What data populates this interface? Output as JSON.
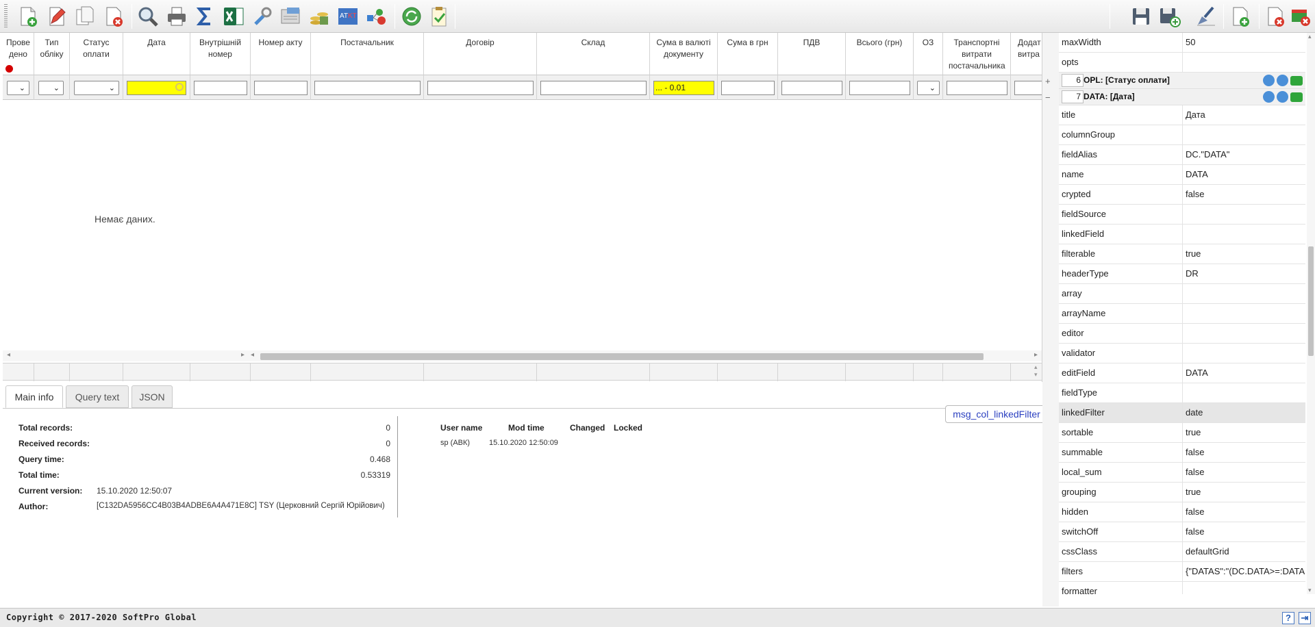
{
  "toolbar": {
    "left_icons": [
      "new-document-icon",
      "edit-icon",
      "copy-icon",
      "delete-icon",
      "search-icon",
      "print-icon",
      "sum-icon",
      "excel-icon",
      "settings-wrench-icon",
      "log-icon",
      "money-icon",
      "convert-icon",
      "dependencies-icon",
      "refresh-icon",
      "approve-icon"
    ],
    "right_icons": [
      "save-icon",
      "save-as-icon",
      "clear-icon",
      "add-column-icon",
      "delete-column-icon",
      "delete-all-icon"
    ]
  },
  "grid": {
    "columns": [
      "Прове дено",
      "Тип обліку",
      "Статус оплати",
      "Дата",
      "Внутрішній номер",
      "Номер акту",
      "Постачальник",
      "Договір",
      "Склад",
      "Сума в валюті документу",
      "Сума в грн",
      "ПДВ",
      "Всього (грн)",
      "ОЗ",
      "Транспортні витрати постачальника",
      "Додат витра"
    ],
    "filter_sum_value": "... - 0.01",
    "empty_message": "Немає даних."
  },
  "tabs": [
    "Main info",
    "Query text",
    "JSON"
  ],
  "info": {
    "labels": [
      "Total records:",
      "Received records:",
      "Query time:",
      "Total time:",
      "Current version:",
      "Author:"
    ],
    "total_records": "0",
    "received_records": "0",
    "query_time": "0.468",
    "total_time": "0.53319",
    "current_version": "15.10.2020 12:50:07",
    "author": "[C132DA5956CC4B03B4ADBE6A4A471E8C] TSY (Церковний Сергій Юрійович)"
  },
  "users": {
    "headers": [
      "User name",
      "Mod time",
      "Changed",
      "Locked"
    ],
    "rows": [
      [
        "sp (АВК)",
        "15.10.2020 12:50:09",
        "",
        ""
      ]
    ]
  },
  "tooltip": "msg_col_linkedFilter",
  "props": {
    "top_rows": [
      [
        "maxWidth",
        "50"
      ],
      [
        "opts",
        ""
      ]
    ],
    "groups": [
      {
        "num": "6",
        "title": "OPL: [Статус оплати]",
        "toggle": "+"
      },
      {
        "num": "7",
        "title": "DATA: [Дата]",
        "toggle": "−"
      }
    ],
    "rows": [
      [
        "title",
        "Дата"
      ],
      [
        "columnGroup",
        ""
      ],
      [
        "fieldAlias",
        "DC.\"DATA\""
      ],
      [
        "name",
        "DATA"
      ],
      [
        "crypted",
        "false"
      ],
      [
        "fieldSource",
        ""
      ],
      [
        "linkedField",
        ""
      ],
      [
        "filterable",
        "true"
      ],
      [
        "headerType",
        "DR"
      ],
      [
        "array",
        ""
      ],
      [
        "arrayName",
        ""
      ],
      [
        "editor",
        ""
      ],
      [
        "validator",
        ""
      ],
      [
        "editField",
        "DATA"
      ],
      [
        "fieldType",
        ""
      ],
      [
        "linkedFilter",
        "date"
      ],
      [
        "sortable",
        "true"
      ],
      [
        "summable",
        "false"
      ],
      [
        "local_sum",
        "false"
      ],
      [
        "grouping",
        "true"
      ],
      [
        "hidden",
        "false"
      ],
      [
        "switchOff",
        "false"
      ],
      [
        "cssClass",
        "defaultGrid"
      ],
      [
        "filters",
        "{\"DATAS\":\"(DC.DATA>=:DATA"
      ],
      [
        "formatter",
        ""
      ]
    ]
  },
  "statusbar": {
    "copyright": "Copyright © 2017-2020 SoftPro Global",
    "help": "?"
  }
}
